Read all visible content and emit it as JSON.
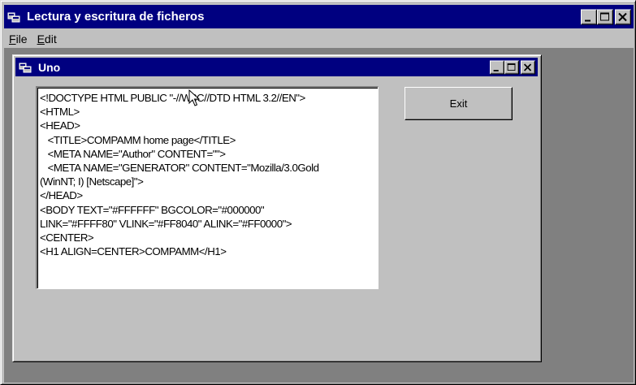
{
  "app": {
    "title": "Lectura y escritura de ficheros",
    "menu": [
      {
        "label": "File",
        "mnemonic": "F",
        "rest": "ile"
      },
      {
        "label": "Edit",
        "mnemonic": "E",
        "rest": "dit"
      }
    ]
  },
  "child": {
    "title": "Uno",
    "text_lines": [
      "<!DOCTYPE HTML PUBLIC \"-//W3C//DTD HTML 3.2//EN\">",
      "<HTML>",
      "<HEAD>",
      "   <TITLE>COMPAMM home page</TITLE>",
      "   <META NAME=\"Author\" CONTENT=\"\">",
      "   <META NAME=\"GENERATOR\" CONTENT=\"Mozilla/3.0Gold",
      "(WinNT; I) [Netscape]\">",
      "</HEAD>",
      "<BODY TEXT=\"#FFFFFF\" BGCOLOR=\"#000000\"",
      "LINK=\"#FFFF80\" VLINK=\"#FF8040\" ALINK=\"#FF0000\">",
      "<CENTER>",
      "",
      "<H1 ALIGN=CENTER>COMPAMM</H1>"
    ],
    "exit_label": "Exit"
  },
  "colors": {
    "titlebar": "#000080",
    "face": "#c0c0c0",
    "mdi_background": "#808080"
  },
  "icons": {
    "app": "app-window-icon",
    "minimize": "minimize-icon",
    "maximize": "maximize-icon",
    "close": "close-icon",
    "cursor": "mouse-pointer-icon"
  }
}
